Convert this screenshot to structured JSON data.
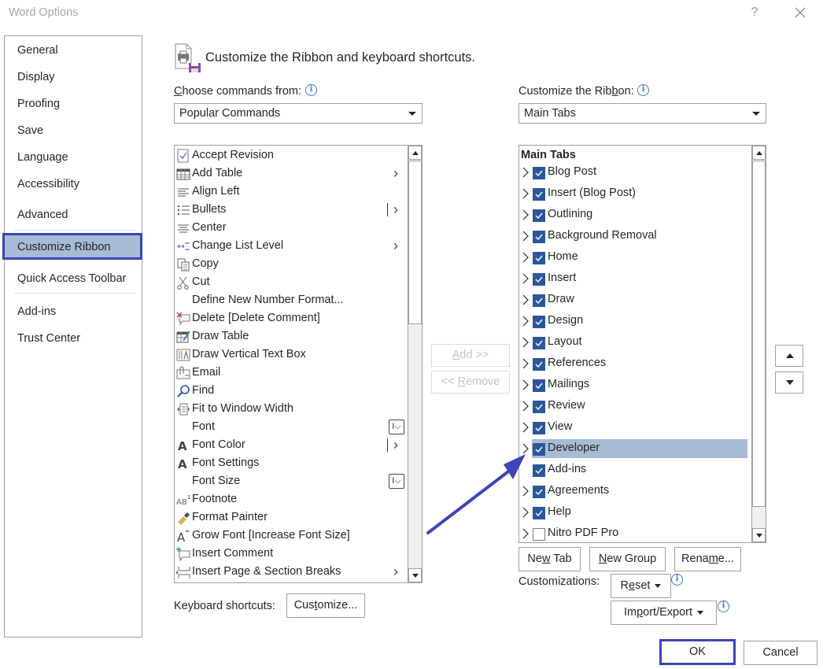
{
  "window": {
    "title": "Word Options",
    "help_label": "?",
    "close_icon": "close-icon"
  },
  "sidebar": {
    "items": [
      {
        "label": "General"
      },
      {
        "label": "Display"
      },
      {
        "label": "Proofing"
      },
      {
        "label": "Save"
      },
      {
        "label": "Language"
      },
      {
        "label": "Accessibility"
      },
      {
        "label": "Advanced"
      },
      {
        "label": "Customize Ribbon",
        "selected": true
      },
      {
        "label": "Quick Access Toolbar"
      },
      {
        "label": "Add-ins"
      },
      {
        "label": "Trust Center"
      }
    ]
  },
  "header": {
    "title": "Customize the Ribbon and keyboard shortcuts.",
    "icon": "customize-ribbon-icon"
  },
  "commands": {
    "label": "Choose commands from:",
    "label_accesskey": "C",
    "selected": "Popular Commands",
    "items": [
      {
        "label": "Accept Revision",
        "icon": "accept-revision-icon",
        "marker": ""
      },
      {
        "label": "Add Table",
        "icon": "table-icon",
        "marker": "submenu"
      },
      {
        "label": "Align Left",
        "icon": "align-left-icon",
        "marker": ""
      },
      {
        "label": "Bullets",
        "icon": "bullets-icon",
        "marker": "split"
      },
      {
        "label": "Center",
        "icon": "align-center-icon",
        "marker": ""
      },
      {
        "label": "Change List Level",
        "icon": "list-level-icon",
        "marker": "submenu"
      },
      {
        "label": "Copy",
        "icon": "copy-icon",
        "marker": ""
      },
      {
        "label": "Cut",
        "icon": "scissors-icon",
        "marker": ""
      },
      {
        "label": "Define New Number Format...",
        "icon": "",
        "marker": ""
      },
      {
        "label": "Delete [Delete Comment]",
        "icon": "delete-comment-icon",
        "marker": ""
      },
      {
        "label": "Draw Table",
        "icon": "draw-table-icon",
        "marker": ""
      },
      {
        "label": "Draw Vertical Text Box",
        "icon": "vertical-text-box-icon",
        "marker": ""
      },
      {
        "label": "Email",
        "icon": "email-icon",
        "marker": ""
      },
      {
        "label": "Find",
        "icon": "find-icon",
        "marker": ""
      },
      {
        "label": "Fit to Window Width",
        "icon": "fit-width-icon",
        "marker": ""
      },
      {
        "label": "Font",
        "icon": "",
        "marker": "combo"
      },
      {
        "label": "Font Color",
        "icon": "font-color-icon",
        "marker": "split"
      },
      {
        "label": "Font Settings",
        "icon": "font-settings-icon",
        "marker": ""
      },
      {
        "label": "Font Size",
        "icon": "",
        "marker": "combo"
      },
      {
        "label": "Footnote",
        "icon": "footnote-icon",
        "marker": ""
      },
      {
        "label": "Format Painter",
        "icon": "format-painter-icon",
        "marker": ""
      },
      {
        "label": "Grow Font [Increase Font Size]",
        "icon": "grow-font-icon",
        "marker": ""
      },
      {
        "label": "Insert Comment",
        "icon": "insert-comment-icon",
        "marker": ""
      },
      {
        "label": "Insert Page & Section Breaks",
        "icon": "page-break-icon",
        "marker": "submenu"
      }
    ]
  },
  "ribbon": {
    "label": "Customize the Ribbon:",
    "selected": "Main Tabs",
    "tree_header": "Main Tabs",
    "tabs": [
      {
        "label": "Blog Post",
        "checked": true,
        "expandable": true
      },
      {
        "label": "Insert (Blog Post)",
        "checked": true,
        "expandable": true
      },
      {
        "label": "Outlining",
        "checked": true,
        "expandable": true
      },
      {
        "label": "Background Removal",
        "checked": true,
        "expandable": true
      },
      {
        "label": "Home",
        "checked": true,
        "expandable": true
      },
      {
        "label": "Insert",
        "checked": true,
        "expandable": true
      },
      {
        "label": "Draw",
        "checked": true,
        "expandable": true
      },
      {
        "label": "Design",
        "checked": true,
        "expandable": true
      },
      {
        "label": "Layout",
        "checked": true,
        "expandable": true
      },
      {
        "label": "References",
        "checked": true,
        "expandable": true
      },
      {
        "label": "Mailings",
        "checked": true,
        "expandable": true
      },
      {
        "label": "Review",
        "checked": true,
        "expandable": true
      },
      {
        "label": "View",
        "checked": true,
        "expandable": true
      },
      {
        "label": "Developer",
        "checked": true,
        "expandable": true,
        "selected": true
      },
      {
        "label": "Add-ins",
        "checked": true,
        "expandable": false
      },
      {
        "label": "Agreements",
        "checked": true,
        "expandable": true
      },
      {
        "label": "Help",
        "checked": true,
        "expandable": true
      },
      {
        "label": "Nitro PDF Pro",
        "checked": false,
        "expandable": true
      }
    ]
  },
  "buttons": {
    "add": "Add >>",
    "remove": "<< Remove",
    "new_tab": "New Tab",
    "new_group": "New Group",
    "rename": "Rename...",
    "customizations_label": "Customizations:",
    "reset": "Reset",
    "import_export": "Import/Export",
    "keyboard_label": "Keyboard shortcuts:",
    "customize": "Customize...",
    "ok": "OK",
    "cancel": "Cancel",
    "move_up_icon": "move-up-icon",
    "move_down_icon": "move-down-icon"
  },
  "annotation": {
    "arrow_color": "#3d45b8",
    "highlight_color": "#3d45b8"
  }
}
